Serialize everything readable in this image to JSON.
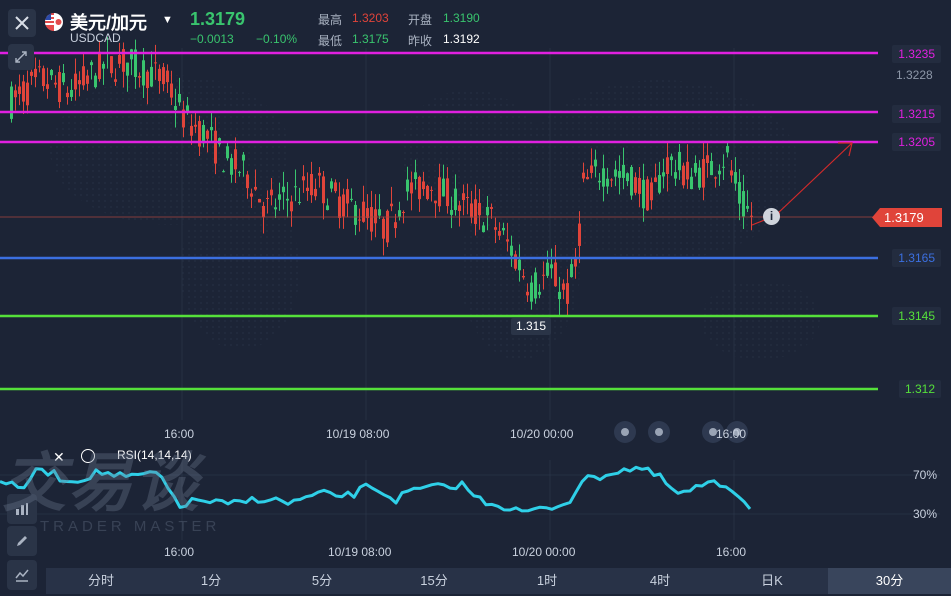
{
  "header": {
    "symbol_name": "美元/加元",
    "symbol_code": "USDCAD",
    "last_price": "1.3179",
    "change": "−0.0013",
    "change_pct": "−0.10%",
    "high_label": "最高",
    "high_value": "1.3203",
    "open_label": "开盘",
    "open_value": "1.3190",
    "low_label": "最低",
    "low_value": "1.3175",
    "prev_close_label": "昨收",
    "prev_close_value": "1.3192"
  },
  "price_axis": {
    "ticks": [
      "1.3228"
    ],
    "levels": [
      {
        "label": "1.3235",
        "color": "#e020e0"
      },
      {
        "label": "1.3215",
        "color": "#e020e0"
      },
      {
        "label": "1.3205",
        "color": "#e020e0"
      },
      {
        "label": "1.3165",
        "color": "#3b6fe0"
      },
      {
        "label": "1.3145",
        "color": "#55e03a"
      },
      {
        "label": "1.312",
        "color": "#55e03a"
      }
    ],
    "current": {
      "label": "1.3179",
      "color": "#e0443a"
    },
    "low_marker": "1.315"
  },
  "time_axis": {
    "labels": [
      "16:00",
      "10/19 08:00",
      "10/20 00:00",
      "16:00"
    ]
  },
  "rsi": {
    "title": "RSI(14,14,14)",
    "level_high": "70%",
    "level_low": "30%"
  },
  "watermark": {
    "main": "交易谈",
    "sub": "TRADER MASTER"
  },
  "tabs": [
    {
      "label": "分时",
      "active": false
    },
    {
      "label": "1分",
      "active": false
    },
    {
      "label": "5分",
      "active": false
    },
    {
      "label": "15分",
      "active": false
    },
    {
      "label": "1时",
      "active": false
    },
    {
      "label": "4时",
      "active": false
    },
    {
      "label": "日K",
      "active": false
    },
    {
      "label": "30分",
      "active": true
    }
  ],
  "colors": {
    "up": "#39c46e",
    "down": "#e0443a",
    "rsi": "#2fd0e8",
    "background": "#1c2436"
  },
  "icons": {
    "close": "close-icon",
    "draw": "pen-icon",
    "indicator": "chart-indicator-icon",
    "settings": "eye-icon",
    "info": "info-icon"
  }
}
